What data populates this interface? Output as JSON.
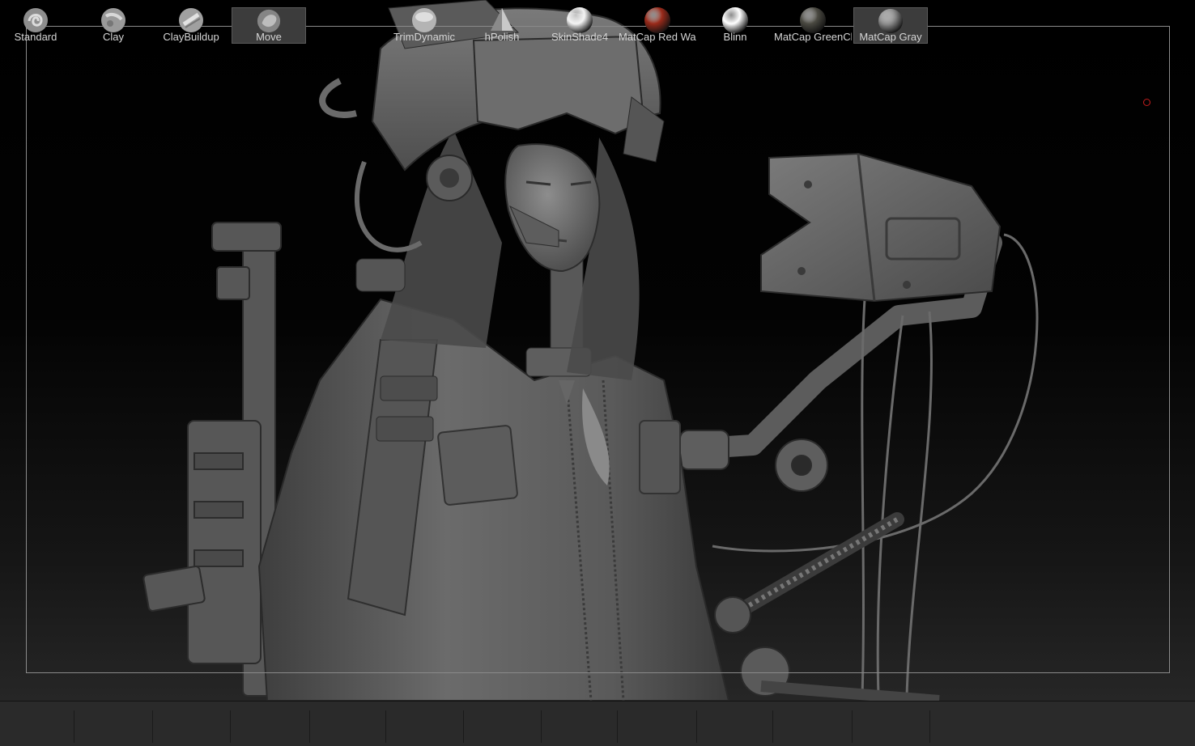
{
  "viewport": {
    "model": "cyberpunk-character-sculpt"
  },
  "brushes": [
    {
      "label": "Standard",
      "icon": "standard-brush-icon",
      "selected": false
    },
    {
      "label": "Clay",
      "icon": "clay-brush-icon",
      "selected": false
    },
    {
      "label": "ClayBuildup",
      "icon": "claybuildup-brush-icon",
      "selected": false
    },
    {
      "label": "Move",
      "icon": "move-brush-icon",
      "selected": true
    }
  ],
  "tools": [
    {
      "label": "TrimDynamic",
      "icon": "trimdynamic-brush-icon"
    },
    {
      "label": "hPolish",
      "icon": "hpolish-brush-icon"
    }
  ],
  "materials": [
    {
      "label": "SkinShade4",
      "icon": "skinshade4-material-icon",
      "color": "#f4f4f4"
    },
    {
      "label": "MatCap Red Wax",
      "icon": "matcap-red-wax-material-icon",
      "color": "#9a2a1a"
    },
    {
      "label": "Blinn",
      "icon": "blinn-material-icon",
      "color": "#ffffff"
    },
    {
      "label": "MatCap GreenClay",
      "icon": "matcap-greenclay-material-icon",
      "color": "#4b4a42"
    },
    {
      "label": "MatCap Gray",
      "icon": "matcap-gray-material-icon",
      "color": "#8a8a8a",
      "selected": true
    }
  ],
  "colors": {
    "shelf_bg": "#2a2a2a",
    "cursor": "#c21d1d",
    "model_gray": "#6e6e6e"
  }
}
